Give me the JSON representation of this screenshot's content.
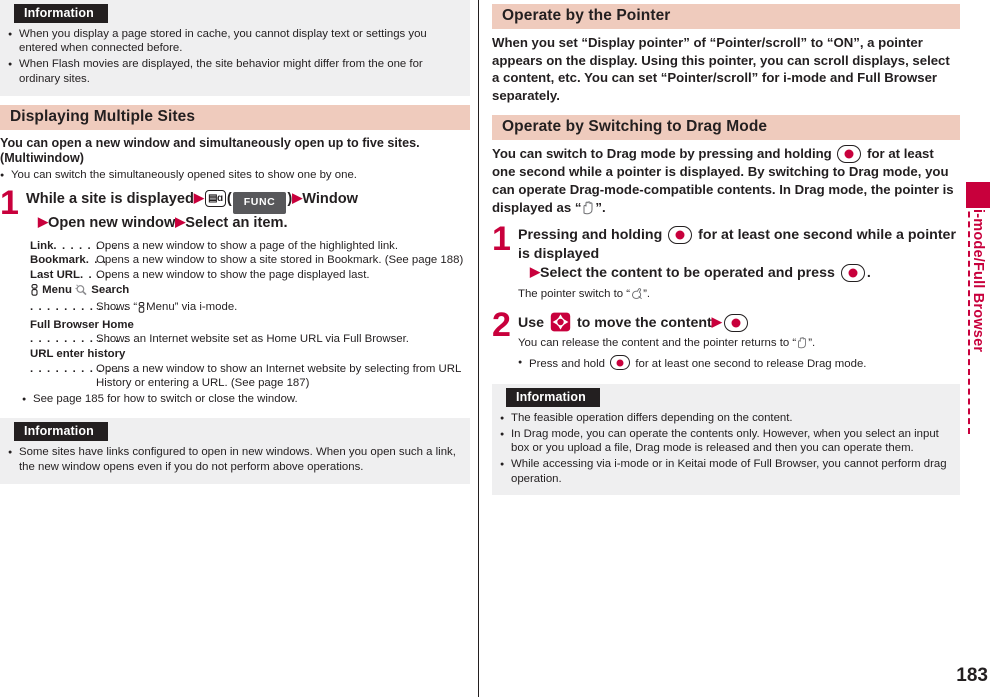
{
  "page": {
    "number": "183",
    "side_tab_label": "i-mode/Full Browser",
    "accent_color": "#c8003c",
    "section_bar_color": "#efcbbd",
    "info_bg_color": "#efeff0"
  },
  "left": {
    "info_top": {
      "title": "Information",
      "items": [
        "When you display a page stored in cache, you cannot display text or settings you entered when connected before.",
        "When Flash movies are displayed, the site behavior might differ from the one for ordinary sites."
      ]
    },
    "section": {
      "title": "Displaying Multiple Sites",
      "lead": "You can open a new window and simultaneously open up to five sites. (Multiwindow)",
      "lead_bullet": "You can switch the simultaneously opened sites to show one by one."
    },
    "step1": {
      "number": "1",
      "head_a": "While a site is displayed",
      "key_icon": "imode-func-key",
      "paren_open": "(",
      "func_label": "FUNC",
      "paren_close": ")",
      "head_b": "Window",
      "head_c": "Open new window",
      "head_d": "Select an item."
    },
    "options": [
      {
        "term": "Link",
        "dots": ". . . . . . . .",
        "desc": "Opens a new window to show a page of the highlighted link."
      },
      {
        "term": "Bookmark",
        "dots": ". . .",
        "desc": "Opens a new window to show a site stored in Bookmark. (See page 188)"
      },
      {
        "term": "Last URL",
        "dots": ". . . .",
        "desc": "Opens a new window to show the page displayed last."
      }
    ],
    "option_imenu": {
      "term_prefix": "",
      "menu_label": "Menu",
      "search_label": "Search",
      "dots": ". . . . . . . . . . . .",
      "desc_a": "Shows “",
      "desc_b": "Menu” via i-mode."
    },
    "option_fbhome": {
      "term": "Full Browser Home",
      "dots": ". . . . . . . . . . . .",
      "desc": "Shows an Internet website set as Home URL via Full Browser."
    },
    "option_urlhist": {
      "term": "URL enter history",
      "dots": ". . . . . . . . . . . .",
      "desc": "Opens a new window to show an Internet website by selecting from URL History or entering a URL. (See page 187)"
    },
    "after_bullet": "See page 185 for how to switch or close the window.",
    "info_bottom": {
      "title": "Information",
      "items": [
        "Some sites have links configured to open in new windows. When you open such a link, the new window opens even if you do not perform above operations."
      ]
    }
  },
  "right": {
    "section_pointer": {
      "title": "Operate by the Pointer",
      "lead": "When you set “Display pointer” of “Pointer/scroll” to “ON”, a pointer appears on the display. Using this pointer, you can scroll displays, select a content, etc. You can set “Pointer/scroll” for i-mode and Full Browser separately."
    },
    "section_drag": {
      "title": "Operate by Switching to Drag Mode",
      "lead_a": "You can switch to Drag mode by pressing and holding",
      "lead_b": "for at least one second while a pointer is displayed. By switching to Drag mode, you can operate Drag-mode-compatible contents. In Drag mode, the pointer is displayed as “",
      "lead_c": "”."
    },
    "step1": {
      "number": "1",
      "head_a": "Pressing and holding",
      "head_b": "for at least one second while a pointer is displayed",
      "sub_a": "Select the content to be operated and press",
      "sub_b": ".",
      "body_a": "The pointer switch to “",
      "body_b": "”."
    },
    "step2": {
      "number": "2",
      "head_a": "Use",
      "head_b": "to move the content",
      "body_a": "You can release the content and the pointer returns to “",
      "body_b": "”.",
      "bullet_a": "Press and hold",
      "bullet_b": "for at least one second to release Drag mode."
    },
    "info": {
      "title": "Information",
      "items": [
        "The feasible operation differs depending on the content.",
        "In Drag mode, you can operate the contents only. However, when you select an input box or you upload a file, Drag mode is released and then you can operate them.",
        "While accessing via i-mode or in Keitai mode of Full Browser, you cannot perform drag operation."
      ]
    }
  },
  "icons": {
    "imode_key": "imode-func-key-icon",
    "center_key": "center-select-key-icon",
    "nav_key": "four-way-navigation-key-icon",
    "hand_open": "open-hand-pointer-icon",
    "hand_grab": "grabbing-hand-pointer-icon",
    "imenu": "imenu-icon",
    "search": "search-magnifier-icon"
  }
}
